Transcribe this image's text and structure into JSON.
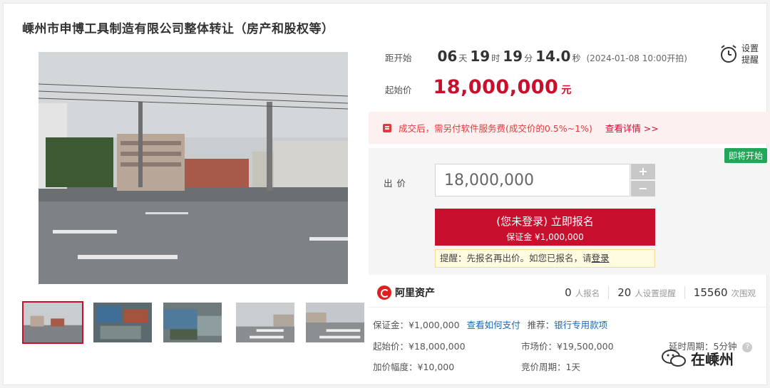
{
  "title": "嵊州市申博工具制造有限公司整体转让（房产和股权等）",
  "countdown": {
    "label": "距开始",
    "days": "06",
    "days_unit": "天",
    "hours": "19",
    "hours_unit": "时",
    "minutes": "19",
    "minutes_unit": "分",
    "seconds": "14.0",
    "seconds_unit": "秒",
    "start_date": "(2024-01-08 10:00开拍)"
  },
  "reminder": {
    "label": "设置提醒",
    "icon": "alarm-clock-icon"
  },
  "start_price": {
    "label": "起始价",
    "value": "18,000,000",
    "unit": "元"
  },
  "fee_notice": {
    "text": "成交后，需另付软件服务费(成交价的0.5%~1%)",
    "link": "查看详情 >>"
  },
  "bid": {
    "badge": "即将开始",
    "label": "出价",
    "value": "18,000,000",
    "plus": "+",
    "minus": "−",
    "signup_main": "(您未登录) 立即报名",
    "signup_sub": "保证金 ¥1,000,000",
    "tip_text": "提醒：先报名再出价。如您已报名，请",
    "tip_link": "登录"
  },
  "platform": {
    "name": "阿里资产"
  },
  "stats": [
    {
      "num": "0",
      "label": "人报名"
    },
    {
      "num": "20",
      "label": "人设置提醒"
    },
    {
      "num": "15560",
      "label": "次围观"
    }
  ],
  "details": {
    "deposit": "保证金：¥1,000,000",
    "how_to_pay": "查看如何支付",
    "recommend": "推荐：",
    "recommend_link": "银行专用款项",
    "start_price": "起始价：¥18,000,000",
    "market_price": "市场价：¥19,500,000",
    "delay": "延时周期：5分钟",
    "increment": "加价幅度：¥10,000",
    "cycle": "竞价周期：1天"
  },
  "watermark": {
    "text": "在嵊州"
  },
  "colors": {
    "accent": "#c8102e",
    "success": "#23a65a",
    "link": "#1a66b3"
  }
}
